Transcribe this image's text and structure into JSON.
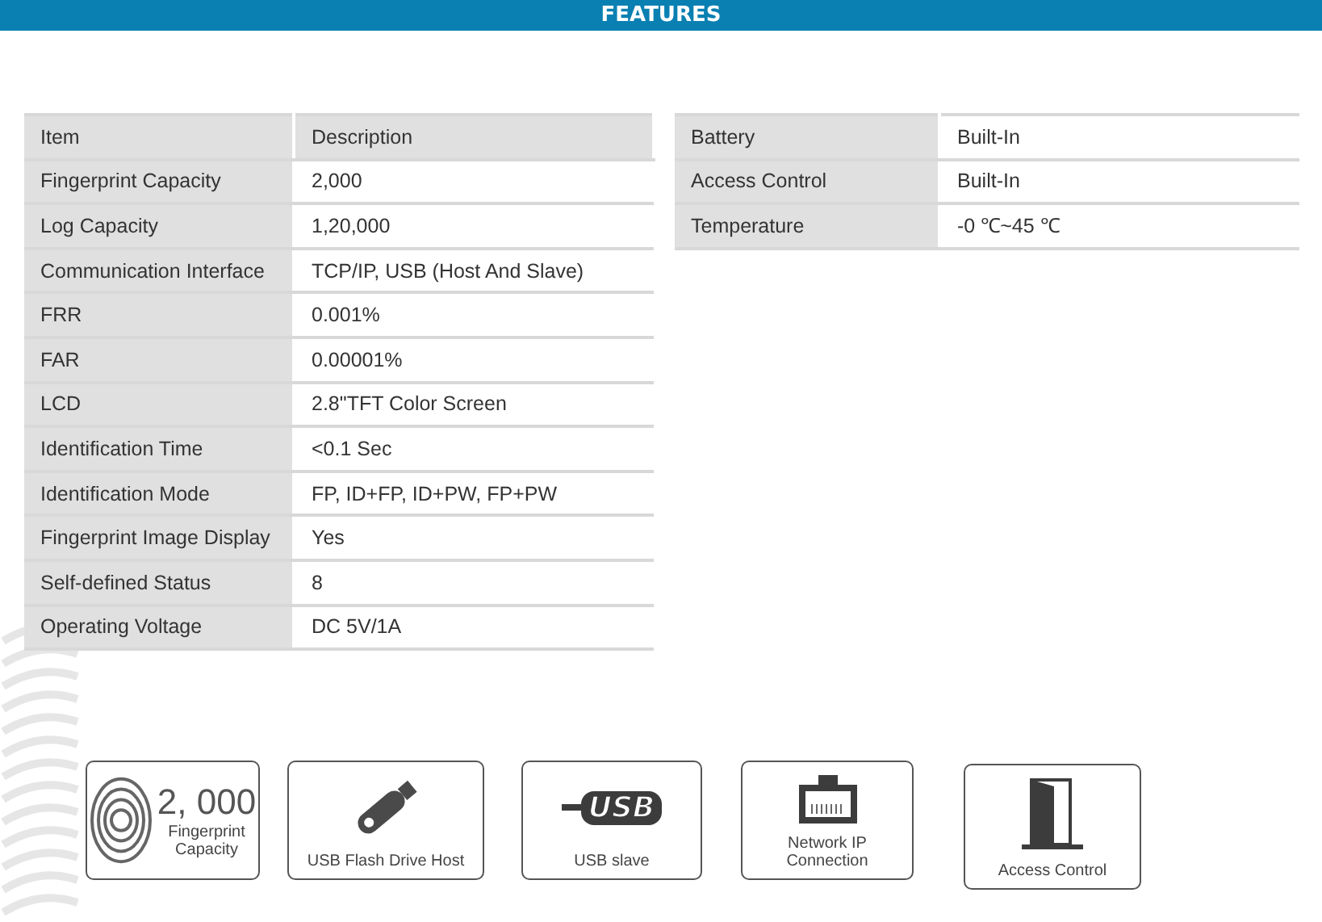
{
  "header": {
    "title": "FEATURES"
  },
  "spec_table": {
    "columns": [
      "Item",
      "Description"
    ],
    "rows": [
      [
        "Fingerprint Capacity",
        "2,000"
      ],
      [
        "Log Capacity",
        "1,20,000"
      ],
      [
        "Communication Interface",
        "TCP/IP, USB (Host And Slave)"
      ],
      [
        "FRR",
        "0.001%"
      ],
      [
        "FAR",
        "0.00001%"
      ],
      [
        "LCD",
        "2.8\"TFT Color Screen"
      ],
      [
        "Identification Time",
        "<0.1 Sec"
      ],
      [
        "Identification Mode",
        "FP, ID+FP, ID+PW, FP+PW"
      ],
      [
        "Fingerprint Image Display",
        "Yes"
      ],
      [
        "Self-defined Status",
        "8"
      ],
      [
        "Operating Voltage",
        "DC 5V/1A"
      ]
    ]
  },
  "extra_table": {
    "rows": [
      [
        "Battery",
        "Built-In"
      ],
      [
        "Access Control",
        "Built-In"
      ],
      [
        "Temperature",
        "-0 ℃~45 ℃"
      ]
    ]
  },
  "feature_cards": [
    {
      "kind": "stat",
      "value": "2, 000",
      "label": "Fingerprint Capacity"
    },
    {
      "kind": "usb-drive",
      "label": "USB Flash Drive Host"
    },
    {
      "kind": "usb-logo",
      "logo_text": "USB",
      "label": "USB slave"
    },
    {
      "kind": "network",
      "label": "Network IP Connection"
    },
    {
      "kind": "door",
      "label": "Access Control"
    }
  ]
}
